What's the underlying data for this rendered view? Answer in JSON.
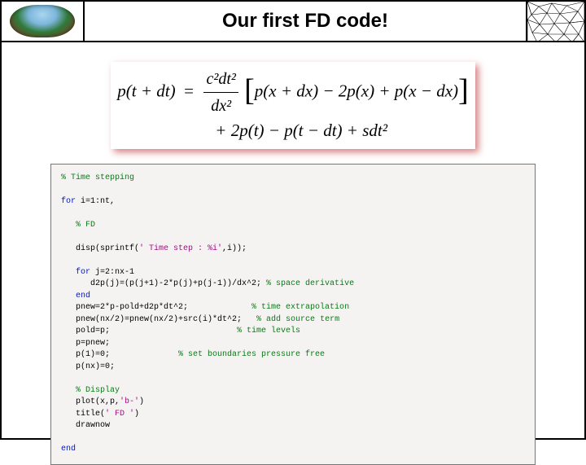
{
  "header": {
    "title": "Our first FD code!"
  },
  "formula": {
    "lhs": "p(t + dt)",
    "coef_num": "c²dt²",
    "coef_den": "dx²",
    "bracket": "p(x + dx) − 2p(x) + p(x − dx)",
    "line2": "+ 2p(t) − p(t − dt) + sdt²"
  },
  "code": {
    "c_time_stepping": "% Time stepping",
    "kw_for_outer": "for",
    "for_outer_cond": " i=1:nt,",
    "c_fd": "% FD",
    "disp_pre": "   disp(sprintf(",
    "disp_str": "' Time step : %i'",
    "disp_post": ",i));",
    "kw_for_inner": "for",
    "for_inner_cond": " j=2:nx-1",
    "d2p_line": "      d2p(j)=(p(j+1)-2*p(j)+p(j-1))/dx^2;",
    "c_space_deriv": " % space derivative",
    "kw_end1": "end",
    "pnew1": "   pnew=2*p-pold+d2p*dt^2;",
    "c_time_extrap": "             % time extrapolation",
    "pnew2": "   pnew(nx/2)=pnew(nx/2)+src(i)*dt^2;",
    "c_add_src": "   % add source term",
    "pold": "   pold=p;",
    "c_time_levels": "                          % time levels",
    "pp": "   p=pnew;",
    "p1": "   p(1)=0;",
    "c_bound": "              % set boundaries pressure free",
    "pnx": "   p(nx)=0;",
    "c_display": "% Display",
    "plot_pre": "   plot(x,p,",
    "plot_str": "'b-'",
    "plot_post": ")",
    "title_pre": "   title(",
    "title_str": "' FD '",
    "title_post": ")",
    "drawnow": "   drawnow",
    "kw_end2": "end"
  }
}
